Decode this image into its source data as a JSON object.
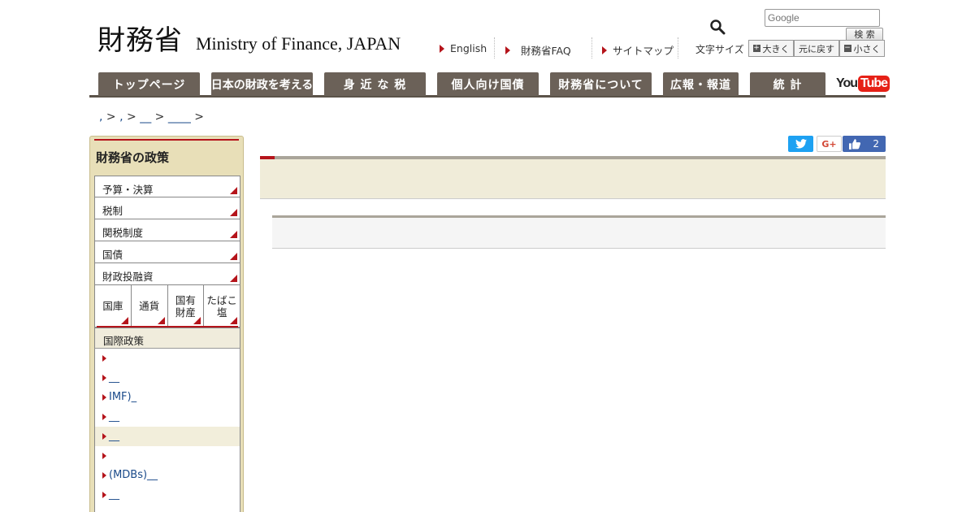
{
  "header": {
    "logo_jp": "財務省",
    "logo_en": "Ministry of Finance, JAPAN",
    "search_placeholder": "Google",
    "search_button": "検 索",
    "util_links": [
      "English",
      "財務省FAQ",
      "サイトマップ"
    ],
    "font_size_label": "文字サイズ",
    "font_size_buttons": [
      "大きく",
      "元に戻す",
      "小さく"
    ]
  },
  "nav": {
    "tabs": [
      "トップページ",
      "日本の財政を考える",
      "身 近 な 税",
      "個人向け国債",
      "財務省について",
      "広報・報道",
      "統 計"
    ],
    "youtube_you": "You",
    "youtube_tube": "Tube"
  },
  "breadcrumb": {
    "items": [
      ",",
      ",",
      "__",
      "____"
    ],
    "sep": ">"
  },
  "social": {
    "like_count": "2"
  },
  "sidebar": {
    "title": "財務省の政策",
    "items": [
      "予算・決算",
      "税制",
      "関税制度",
      "国債",
      "財政投融資"
    ],
    "grid": [
      "国庫",
      "通貨",
      "国有\n財産",
      "たばこ\n塩"
    ],
    "section": "国際政策",
    "links": [
      "",
      "__",
      "IMF)_",
      "__",
      "__",
      "",
      "(MDBs)__",
      "__",
      ","
    ]
  },
  "colors": {
    "nav_bg": "#6b6158",
    "accent_red": "#b5141b",
    "sidebar_bg": "#e8dfb8",
    "link": "#1a4a8a"
  }
}
